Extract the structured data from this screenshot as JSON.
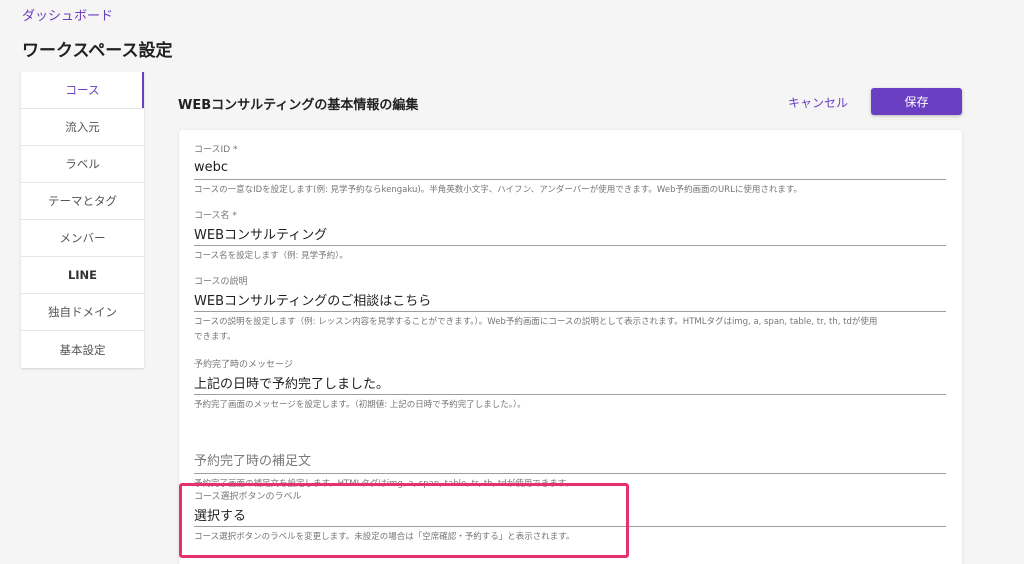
{
  "breadcrumb": "ダッシュボード",
  "page_title": "ワークスペース設定",
  "sidebar": {
    "items": [
      {
        "label": "コース"
      },
      {
        "label": "流入元"
      },
      {
        "label": "ラベル"
      },
      {
        "label": "テーマとタグ"
      },
      {
        "label": "メンバー"
      },
      {
        "label": "LINE"
      },
      {
        "label": "独自ドメイン"
      },
      {
        "label": "基本設定"
      }
    ]
  },
  "main": {
    "section_title": "WEBコンサルティングの基本情報の編集",
    "cancel_label": "キャンセル",
    "save_label": "保存"
  },
  "form": {
    "course_id": {
      "label": "コースID *",
      "value": "webc",
      "help": "コースの一意なIDを設定します(例: 見学予約ならkengaku)。半角英数小文字、ハイフン、アンダーバーが使用できます。Web予約画面のURLに使用されます。"
    },
    "course_name": {
      "label": "コース名 *",
      "value": "WEBコンサルティング",
      "help": "コース名を設定します（例: 見学予約）。"
    },
    "course_description": {
      "label": "コースの説明",
      "value": "WEBコンサルティングのご相談はこちら",
      "help_line1": "コースの説明を設定します（例: レッスン内容を見学することができます。）。Web予約画面にコースの説明として表示されます。HTMLタグはimg, a, span, table, tr, th, tdが使用",
      "help_line2": "できます。"
    },
    "completion_message": {
      "label": "予約完了時のメッセージ",
      "value": "上記の日時で予約完了しました。",
      "help": "予約完了画面のメッセージを設定します。（初期値: 上記の日時で予約完了しました。）。"
    },
    "completion_note": {
      "placeholder": "予約完了時の補足文",
      "help": "予約完了画面の補足文を設定します。HTMLタグはimg, a, span, table, tr, th, tdが使用できます。"
    },
    "select_button_label": {
      "label": "コース選択ボタンのラベル",
      "value": "選択する",
      "help": "コース選択ボタンのラベルを変更します。未設定の場合は「空席確認・予約する」と表示されます。"
    }
  },
  "colors": {
    "accent": "#6a3fc1",
    "highlight": "#e8306f"
  }
}
